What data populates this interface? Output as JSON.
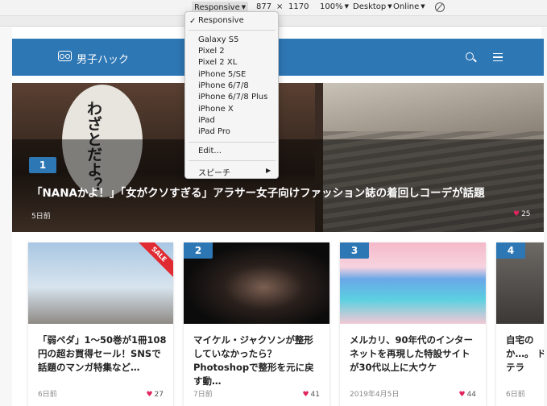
{
  "devtools": {
    "device_label": "Responsive",
    "width": "877",
    "times": "×",
    "height": "1170",
    "zoom": "100%",
    "device_type": "Desktop",
    "network": "Online"
  },
  "device_menu": {
    "selected": "Responsive",
    "devices": [
      "Galaxy S5",
      "Pixel 2",
      "Pixel 2 XL",
      "iPhone 5/SE",
      "iPhone 6/7/8",
      "iPhone 6/7/8 Plus",
      "iPhone X",
      "iPad",
      "iPad Pro"
    ],
    "edit_label": "Edit...",
    "speech_label": "スピーチ"
  },
  "site": {
    "logo_text": "男子ハック",
    "brand_color": "#2e77b5"
  },
  "hero": {
    "rank": "1",
    "bubble_text": "わざとだよ？",
    "title": "「NANAかよ！」「女がクソすぎる」アラサー女子向けファッション誌の着回しコーデが話題",
    "date": "5日前",
    "likes": "25"
  },
  "cards": [
    {
      "rank": "",
      "sale": "SALE",
      "title": "「弱ペダ」1〜50巻が1冊108円の超お買得セール！SNSで話題のマンガ特集など…",
      "date": "6日前",
      "likes": "27"
    },
    {
      "rank": "2",
      "title": "マイケル・ジャクソンが整形していなかったら？Photoshopで整形を元に戻す動…",
      "date": "7日前",
      "likes": "41"
    },
    {
      "rank": "3",
      "title": "メルカリ、90年代のインターネットを再現した特設サイトが30代以上に大ウケ",
      "date": "2019年4月5日",
      "likes": "44"
    },
    {
      "rank": "4",
      "title": "自宅の か…。 ドテラ",
      "date": "6日前",
      "likes": ""
    }
  ]
}
